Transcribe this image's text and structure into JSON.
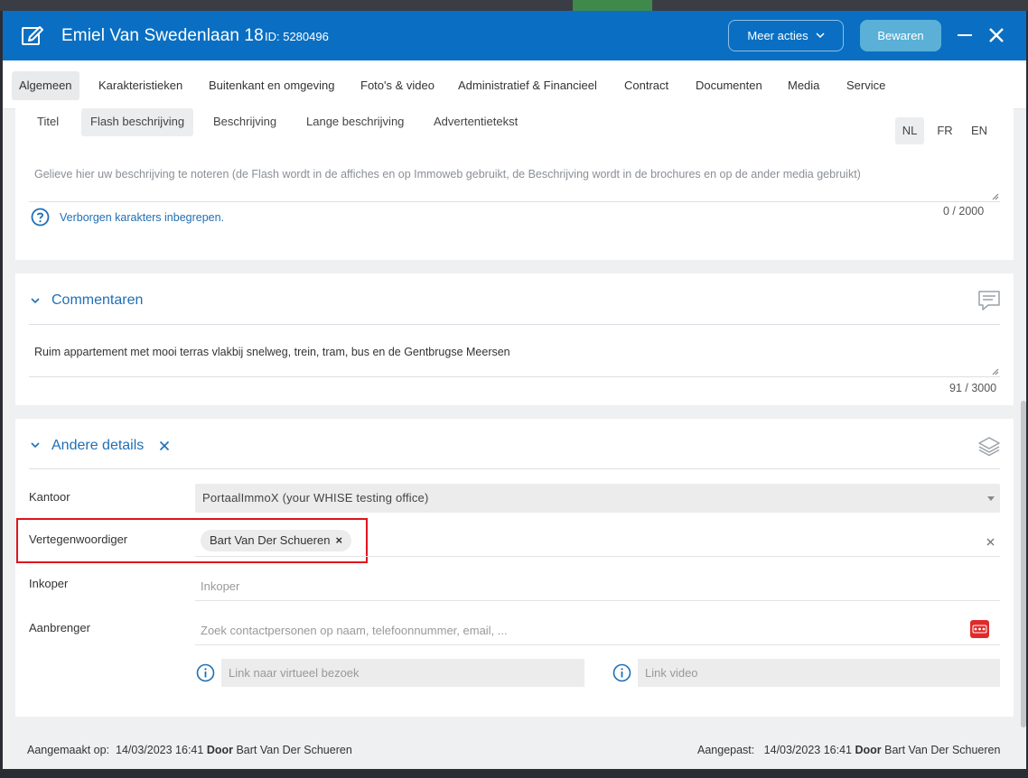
{
  "window": {
    "title": "Emiel Van Swedenlaan 18",
    "id_label": "ID: 5280496",
    "more_actions": "Meer acties",
    "save": "Bewaren"
  },
  "tabs": [
    {
      "label": "Algemeen",
      "active": true
    },
    {
      "label": "Karakteristieken"
    },
    {
      "label": "Buitenkant en omgeving"
    },
    {
      "label": "Foto's & video"
    },
    {
      "label": "Administratief & Financieel"
    },
    {
      "label": "Contract"
    },
    {
      "label": "Documenten"
    },
    {
      "label": "Media"
    },
    {
      "label": "Service"
    }
  ],
  "description": {
    "subtabs": [
      {
        "label": "Titel"
      },
      {
        "label": "Flash beschrijving",
        "active": true
      },
      {
        "label": "Beschrijving"
      },
      {
        "label": "Lange beschrijving"
      },
      {
        "label": "Advertentietekst"
      }
    ],
    "languages": [
      {
        "label": "NL",
        "active": true
      },
      {
        "label": "FR"
      },
      {
        "label": "EN"
      }
    ],
    "placeholder": "Gelieve hier uw beschrijving te noteren (de Flash wordt in de affiches en op Immoweb gebruikt, de Beschrijving wordt in de brochures en op de ander media gebruikt)",
    "hidden_chars": "Verborgen karakters inbegrepen.",
    "counter": "0 / 2000"
  },
  "comments": {
    "title": "Commentaren",
    "text": "Ruim appartement met mooi terras vlakbij snelweg, trein, tram, bus en de Gentbrugse Meersen",
    "counter": "91 / 3000"
  },
  "other_details": {
    "title": "Andere details",
    "office_label": "Kantoor",
    "office_value": "PortaalImmoX (your WHISE testing office)",
    "representative_label": "Vertegenwoordiger",
    "representative_chip": "Bart Van Der Schueren",
    "buyer_label": "Inkoper",
    "buyer_placeholder": "Inkoper",
    "referrer_label": "Aanbrenger",
    "referrer_placeholder": "Zoek contactpersonen op naam, telefoonnummer, email, ...",
    "virtual_tour_placeholder": "Link naar virtueel bezoek",
    "video_placeholder": "Link video"
  },
  "footer": {
    "created_label": "Aangemaakt op:",
    "created_date": "14/03/2023 16:41",
    "by": "Door",
    "created_by": "Bart Van Der Schueren",
    "modified_label": "Aangepast:",
    "modified_date": "14/03/2023 16:41",
    "modified_by": "Bart Van Der Schueren"
  },
  "colors": {
    "header": "#0a6fc2",
    "accent": "#1f6fb5",
    "save_button": "#5ab0d6",
    "highlight": "#e0121c"
  }
}
